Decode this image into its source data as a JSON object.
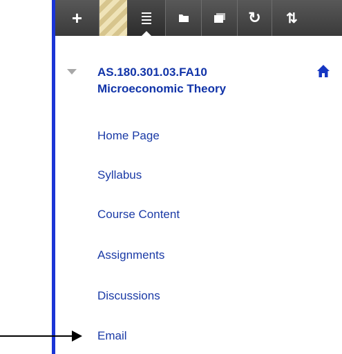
{
  "toolbar": {
    "buttons": [
      {
        "icon": "plus-icon",
        "glyph": "+"
      },
      {
        "icon": "hatch-pattern"
      },
      {
        "icon": "list-icon"
      },
      {
        "icon": "folder-icon"
      },
      {
        "icon": "window-icon"
      },
      {
        "icon": "refresh-icon",
        "glyph": "↻"
      },
      {
        "icon": "sort-icon",
        "glyph": "⇅"
      }
    ]
  },
  "course": {
    "code": "AS.180.301.03.FA10",
    "name": "Microeconomic Theory",
    "toggle_icon": "triangle-down-icon",
    "home_icon": "home-icon"
  },
  "menu": {
    "items": [
      {
        "label": "Home Page"
      },
      {
        "label": "Syllabus"
      },
      {
        "label": "Course Content"
      },
      {
        "label": "Assignments"
      },
      {
        "label": "Discussions"
      },
      {
        "label": "Email"
      }
    ]
  },
  "colors": {
    "link": "#1a3aa6",
    "border": "#1b35d6",
    "toolbar": "#484848"
  }
}
